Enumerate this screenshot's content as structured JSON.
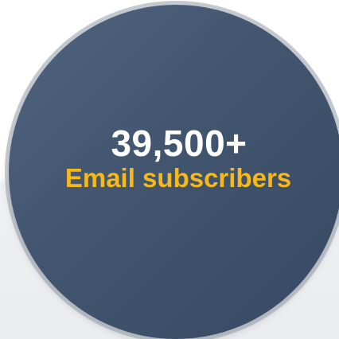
{
  "stat": {
    "value": "39,500+",
    "label": "Email subscribers"
  },
  "colors": {
    "circle": "#42556f",
    "value_text": "#ffffff",
    "label_text": "#f5b91c"
  }
}
